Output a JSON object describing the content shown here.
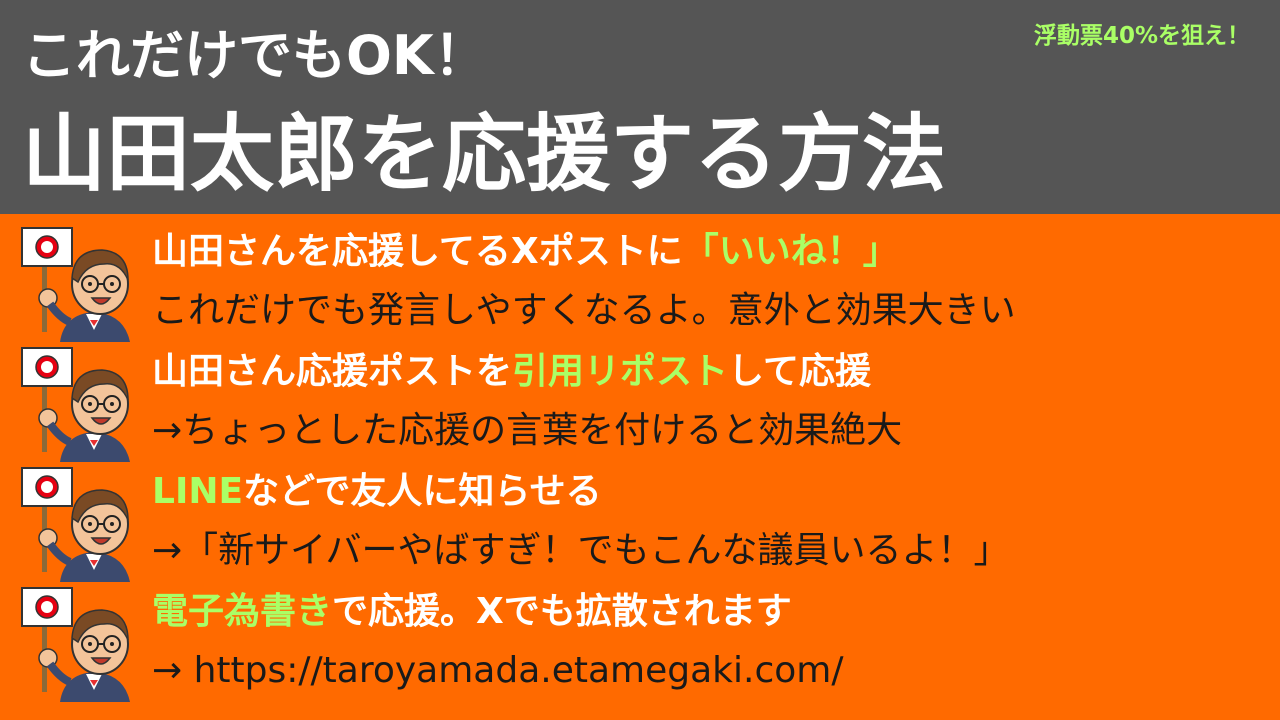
{
  "header": {
    "subtitle": "これだけでもOK！",
    "title": "山田太郎を応援する方法",
    "badge": "浮動票40%を狙え！"
  },
  "items": [
    {
      "line1": [
        {
          "text": "山田さんを応援してるXポストに"
        },
        {
          "text": "「いいね！」"
        }
      ],
      "line2": "これだけでも発言しやすくなるよ。意外と効果大きい"
    },
    {
      "line1": [
        {
          "text": "山田さん応援ポストを"
        },
        {
          "text": "引用リポスト"
        },
        {
          "text": "して応援"
        }
      ],
      "line2": "→ちょっとした応援の言葉を付けると効果絶大"
    },
    {
      "line1": [
        {
          "text": "LINE"
        },
        {
          "text": "などで友人に知らせる"
        }
      ],
      "line2": "→「新サイバーやばすぎ！でもこんな議員いるよ！」"
    },
    {
      "line1": [
        {
          "text": "電子為書き"
        },
        {
          "text": "で応援。Xでも拡散されます"
        }
      ],
      "line2": "→ https://taroyamada.etamegaki.com/"
    }
  ],
  "colors": {
    "background": "#ff6a00",
    "header": "#555555",
    "highlight": "#aaff66",
    "text_white": "#ffffff",
    "text_dark": "#1a1a1a"
  },
  "icons": {
    "avatar": "man-holding-rising-sun-flag-icon"
  }
}
